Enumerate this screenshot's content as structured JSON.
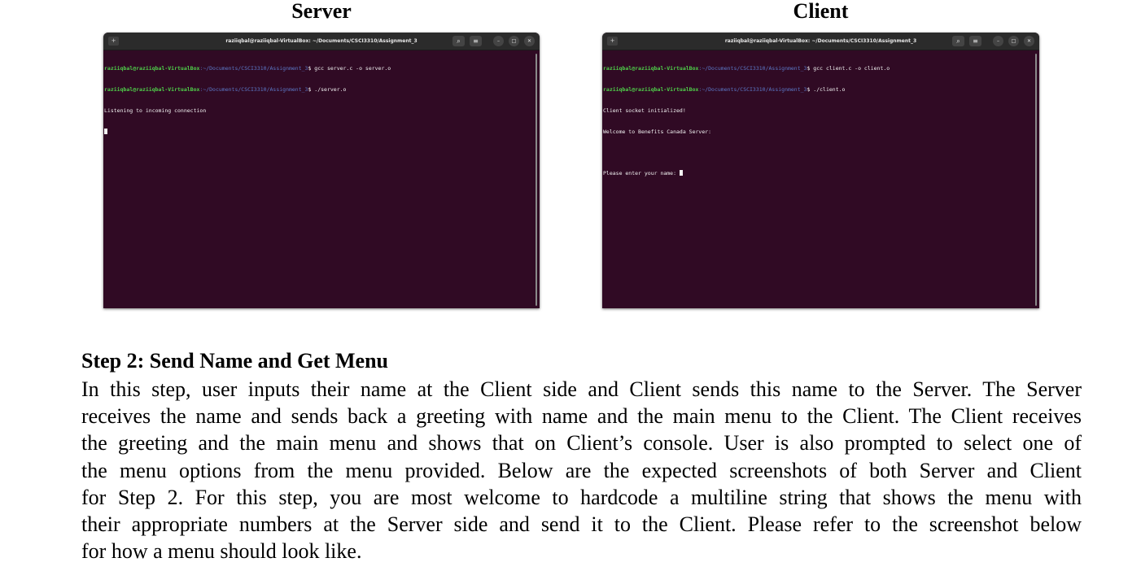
{
  "figure": {
    "server_title": "Server",
    "client_title": "Client"
  },
  "server_terminal": {
    "window_title": "raziiqbal@raziiqbal-VirtualBox: ~/Documents/CSCI3310/Assignment_3",
    "lines": [
      {
        "user": "raziiqbal@raziiqbal-VirtualBox",
        "path": ":~/Documents/CSCI3310/Assignment_3",
        "cmd": "$ gcc server.c -o server.o"
      },
      {
        "user": "raziiqbal@raziiqbal-VirtualBox",
        "path": ":~/Documents/CSCI3310/Assignment_3",
        "cmd": "$ ./server.o"
      }
    ],
    "output": [
      "Listening to incoming connection"
    ]
  },
  "client_terminal": {
    "window_title": "raziiqbal@raziiqbal-VirtualBox: ~/Documents/CSCI3310/Assignment_3",
    "lines": [
      {
        "user": "raziiqbal@raziiqbal-VirtualBox",
        "path": ":~/Documents/CSCI3310/Assignment_3",
        "cmd": "$ gcc client.c -o client.o"
      },
      {
        "user": "raziiqbal@raziiqbal-VirtualBox",
        "path": ":~/Documents/CSCI3310/Assignment_3",
        "cmd": "$ ./client.o"
      }
    ],
    "output": [
      "Client socket initialized!",
      "Welcome to Benefits Canada Server:"
    ],
    "prompt": "Please enter your name: "
  },
  "icons": {
    "new_tab": "new-tab-icon",
    "search": "search-icon",
    "menu": "hamburger-menu-icon",
    "minimize": "minimize-icon",
    "maximize": "maximize-icon",
    "close": "close-icon"
  },
  "colors": {
    "terminal_bg": "#300a24",
    "titlebar_bg": "#2b2b2b",
    "prompt_user": "#4fd04a",
    "prompt_path": "#5b78c7"
  },
  "step": {
    "heading": "Step 2: Send Name and Get Menu",
    "paragraph_lines": [
      "In this step, user inputs their name at the Client side and Client sends this name to the Server. The Server",
      "receives the name and sends back a greeting with name and the main menu to the Client. The Client receives",
      "the greeting and the main menu and shows that on Client’s console. User is also prompted to select one of",
      "the menu options from the menu provided. Below are the expected screenshots of both Server and Client",
      "for Step 2. For this step, you are most welcome to hardcode a multiline string that shows the menu with",
      "their appropriate numbers at the Server side and send it to the Client. Please refer to the screenshot below",
      "for how a menu should look like."
    ]
  }
}
